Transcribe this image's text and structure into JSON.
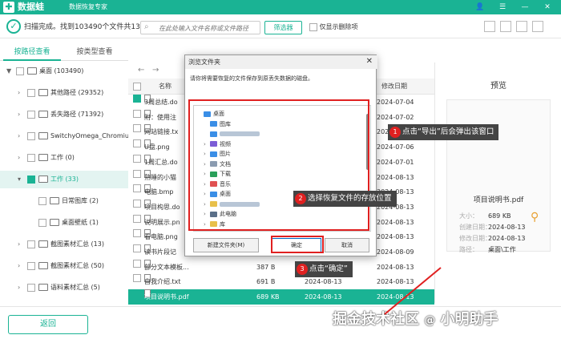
{
  "app": {
    "logo_mark": "✚",
    "name": "数据蛙",
    "subtitle": "数据恢复专家",
    "win_controls": [
      "👤",
      "☰",
      "—",
      "✕"
    ]
  },
  "status": {
    "text": "扫描完成。找到103490个文件共13.2 GB。"
  },
  "search": {
    "placeholder": "在此处输入文件名称或文件路径",
    "icon": "search-icon"
  },
  "filter": {
    "label": "筛选器"
  },
  "deleted_only": {
    "label": "仅显示删除项"
  },
  "tabs": [
    {
      "label": "按路径查看"
    },
    {
      "label": "按类型查看"
    }
  ],
  "tree": [
    {
      "arrow": "▼",
      "label": "桌面 (103490)",
      "indent": 0,
      "checked": false
    },
    {
      "arrow": "›",
      "label": "其他路径 (29352)",
      "indent": 1,
      "checked": false
    },
    {
      "arrow": "›",
      "label": "丢失路径 (71392)",
      "indent": 1,
      "checked": false
    },
    {
      "arrow": "›",
      "label": "SwitchyOmega_Chromium",
      "indent": 1,
      "checked": false
    },
    {
      "arrow": "›",
      "label": "工作 (0)",
      "indent": 1,
      "checked": false
    },
    {
      "arrow": "▾",
      "label": "工作 (33)",
      "indent": 1,
      "checked": true,
      "selected": true
    },
    {
      "arrow": "",
      "label": "日常图库 (2)",
      "indent": 2,
      "checked": false
    },
    {
      "arrow": "",
      "label": "桌面壁纸 (1)",
      "indent": 2,
      "checked": false
    },
    {
      "arrow": "›",
      "label": "截图素材汇总 (13)",
      "indent": 1,
      "checked": false
    },
    {
      "arrow": "›",
      "label": "截图素材汇总 (50)",
      "indent": 1,
      "checked": false
    },
    {
      "arrow": "›",
      "label": "语料素材汇总 (5)",
      "indent": 1,
      "checked": false
    }
  ],
  "list": {
    "header": {
      "name": "名称",
      "date": "修改日期"
    },
    "rows": [
      {
        "name": "3周总结.do",
        "size": "",
        "ctime": "",
        "mtime": "2024-07-04",
        "checked": true
      },
      {
        "name": "附：使用注",
        "size": "",
        "ctime": "",
        "mtime": "2024-07-02",
        "checked": false
      },
      {
        "name": "网站链接.tx",
        "size": "",
        "ctime": "",
        "mtime": "2024-08-13",
        "checked": false
      },
      {
        "name": "U盘.png",
        "size": "",
        "ctime": "",
        "mtime": "2024-07-06",
        "checked": false
      },
      {
        "name": "1周汇总.do",
        "size": "",
        "ctime": "",
        "mtime": "2024-07-01",
        "checked": false
      },
      {
        "name": "熟睡的小猫",
        "size": "",
        "ctime": "",
        "mtime": "2024-08-13",
        "checked": false
      },
      {
        "name": "电脑.bmp",
        "size": "",
        "ctime": "",
        "mtime": "2024-08-13",
        "checked": false
      },
      {
        "name": "项目构思.do",
        "size": "",
        "ctime": "",
        "mtime": "2024-08-13",
        "checked": false
      },
      {
        "name": "说明展示.pn",
        "size": "",
        "ctime": "",
        "mtime": "2024-08-13",
        "checked": false
      },
      {
        "name": "看电脑.png",
        "size": "",
        "ctime": "",
        "mtime": "2024-08-13",
        "checked": false
      },
      {
        "name": "读书片段记",
        "size": "",
        "ctime": "",
        "mtime": "2024-08-09",
        "checked": false
      },
      {
        "name": "部分文本模板...",
        "size": "387 B",
        "ctime": "2024-08-13",
        "mtime": "2024-08-13",
        "checked": false
      },
      {
        "name": "自我介绍.txt",
        "size": "691 B",
        "ctime": "2024-08-13",
        "mtime": "2024-08-13",
        "checked": false
      },
      {
        "name": "项目说明书.pdf",
        "size": "689 KB",
        "ctime": "2024-08-13",
        "mtime": "2024-08-13",
        "checked": true,
        "selected": true
      }
    ]
  },
  "preview": {
    "title": "预览",
    "filename": "项目说明书.pdf",
    "meta": [
      {
        "key": "大小：",
        "value": "689 KB"
      },
      {
        "key": "创建日期：",
        "value": "2024-08-13"
      },
      {
        "key": "修改日期：",
        "value": "2024-08-13"
      },
      {
        "key": "路径：",
        "value": "桌面\\工作"
      }
    ]
  },
  "bottom": {
    "back_label": "返回"
  },
  "dialog": {
    "title": "浏览文件夹",
    "close": "✕",
    "message": "请你将需要恢复的文件保存到原丢失数据的磁盘。",
    "items": [
      {
        "arrow": "",
        "label": "桌面",
        "indent": 0,
        "color": "#3a8ee6"
      },
      {
        "arrow": "",
        "label": "图库",
        "indent": 1,
        "color": "#3a8ee6"
      },
      {
        "arrow": "",
        "label": "",
        "indent": 1,
        "color": "#3a8ee6",
        "blur": true
      },
      {
        "arrow": "›",
        "label": "视频",
        "indent": 1,
        "color": "#7b5cd6"
      },
      {
        "arrow": "›",
        "label": "图片",
        "indent": 1,
        "color": "#3a8ee6"
      },
      {
        "arrow": "›",
        "label": "文档",
        "indent": 1,
        "color": "#8a9bb0"
      },
      {
        "arrow": "›",
        "label": "下载",
        "indent": 1,
        "color": "#2aa05a"
      },
      {
        "arrow": "›",
        "label": "音乐",
        "indent": 1,
        "color": "#e05050"
      },
      {
        "arrow": "›",
        "label": "桌面",
        "indent": 1,
        "color": "#3a8ee6"
      },
      {
        "arrow": "›",
        "label": "",
        "indent": 1,
        "color": "#e8c04a",
        "blur": true
      },
      {
        "arrow": "›",
        "label": "此电脑",
        "indent": 1,
        "color": "#5a6f88"
      },
      {
        "arrow": "›",
        "label": "库",
        "indent": 1,
        "color": "#e8c04a"
      }
    ],
    "new_folder": "新建文件夹(M)",
    "ok": "确定",
    "cancel": "取消"
  },
  "callouts": [
    {
      "num": "1",
      "text": "点击“导出”后会弹出该窗口"
    },
    {
      "num": "2",
      "text": "选择恢复文件的存放位置"
    },
    {
      "num": "3",
      "text": "点击“确定”"
    }
  ],
  "watermark": {
    "text": "掘金技术社区 ",
    "at": "@",
    "handle": " 小明助手"
  },
  "colors": {
    "accent": "#1ab394",
    "annotation": "#e02020"
  }
}
